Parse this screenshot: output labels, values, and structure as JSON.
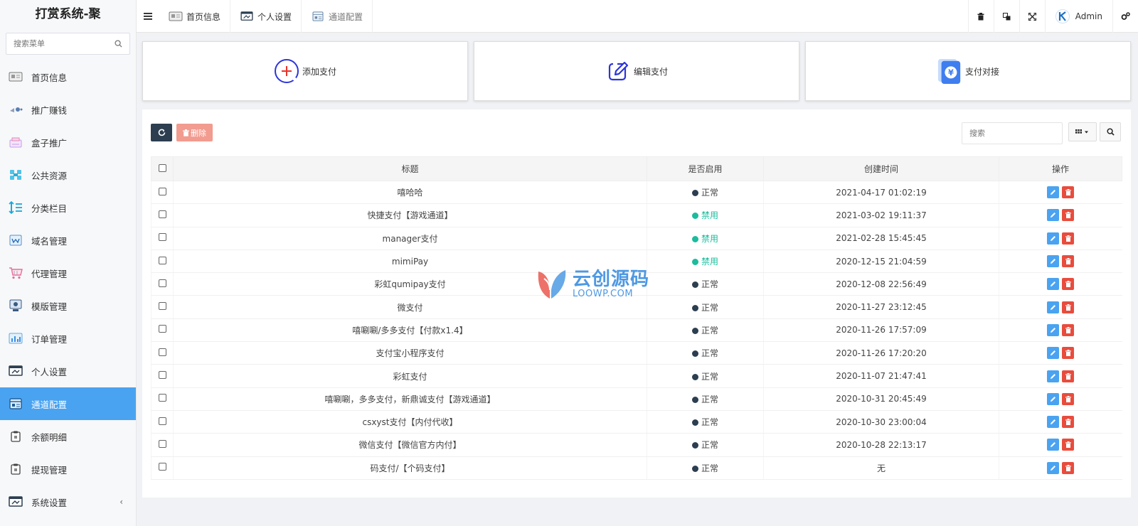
{
  "app": {
    "title": "打赏系统-聚"
  },
  "sidebar": {
    "search_placeholder": "搜索菜单",
    "items": [
      {
        "label": "首页信息",
        "icon": "home-info-icon"
      },
      {
        "label": "推广赚钱",
        "icon": "promotion-icon"
      },
      {
        "label": "盒子推广",
        "icon": "box-promotion-icon"
      },
      {
        "label": "公共资源",
        "icon": "public-resource-icon"
      },
      {
        "label": "分类栏目",
        "icon": "category-icon"
      },
      {
        "label": "域名管理",
        "icon": "domain-icon"
      },
      {
        "label": "代理管理",
        "icon": "agent-cart-icon"
      },
      {
        "label": "模版管理",
        "icon": "template-icon"
      },
      {
        "label": "订单管理",
        "icon": "order-icon"
      },
      {
        "label": "个人设置",
        "icon": "personal-settings-icon"
      },
      {
        "label": "通道配置",
        "icon": "channel-config-icon",
        "active": true
      },
      {
        "label": "余额明细",
        "icon": "balance-icon"
      },
      {
        "label": "提现管理",
        "icon": "withdraw-icon"
      },
      {
        "label": "系统设置",
        "icon": "system-settings-icon",
        "has_submenu": true
      }
    ]
  },
  "topbar": {
    "tabs": [
      {
        "label": "首页信息",
        "icon": "home-info-icon"
      },
      {
        "label": "个人设置",
        "icon": "personal-settings-icon"
      },
      {
        "label": "通道配置",
        "icon": "channel-config-icon"
      }
    ],
    "user": "Admin"
  },
  "shortcuts": [
    {
      "label": "添加支付",
      "icon": "add-circle-icon"
    },
    {
      "label": "编辑支付",
      "icon": "edit-pen-icon"
    },
    {
      "label": "支付对接",
      "icon": "payment-yen-icon"
    }
  ],
  "toolbar": {
    "delete_label": "删除",
    "search_placeholder": "搜索"
  },
  "table": {
    "headers": {
      "title": "标题",
      "enabled": "是否启用",
      "created": "创建时间",
      "actions": "操作"
    },
    "rows": [
      {
        "title": "嘻哈哈",
        "status": "正常",
        "time": "2021-04-17 01:02:19"
      },
      {
        "title": "快捷支付【游戏通道】",
        "status": "禁用",
        "time": "2021-03-02 19:11:37"
      },
      {
        "title": "manager支付",
        "status": "禁用",
        "time": "2021-02-28 15:45:45"
      },
      {
        "title": "mimiPay",
        "status": "禁用",
        "time": "2020-12-15 21:04:59"
      },
      {
        "title": "彩虹qumipay支付",
        "status": "正常",
        "time": "2020-12-08 22:56:49"
      },
      {
        "title": "微支付",
        "status": "正常",
        "time": "2020-11-27 23:12:45"
      },
      {
        "title": "嘻唰唰/多多支付【付款x1.4】",
        "status": "正常",
        "time": "2020-11-26 17:57:09"
      },
      {
        "title": "支付宝小程序支付",
        "status": "正常",
        "time": "2020-11-26 17:20:20"
      },
      {
        "title": "彩虹支付",
        "status": "正常",
        "time": "2020-11-07 21:47:41"
      },
      {
        "title": "嘻唰唰，多多支付，新鼎诚支付【游戏通道】",
        "status": "正常",
        "time": "2020-10-31 20:45:49"
      },
      {
        "title": "csxyst支付【内付代收】",
        "status": "正常",
        "time": "2020-10-30 23:00:04"
      },
      {
        "title": "微信支付【微信官方内付】",
        "status": "正常",
        "time": "2020-10-28 22:13:17"
      },
      {
        "title": "码支付/【个码支付】",
        "status": "正常",
        "time": "无"
      }
    ]
  },
  "status_colors": {
    "正常": "#2c3e50",
    "禁用": "#1abc9c"
  },
  "status_text_colors": {
    "正常": "#444444",
    "禁用": "#1abc9c"
  },
  "watermark": {
    "cn": "云创源码",
    "en": "LOOWP.COM"
  },
  "colors": {
    "accent": "#4aa3f0",
    "danger": "#e84c3d",
    "dark": "#2c3e50"
  }
}
